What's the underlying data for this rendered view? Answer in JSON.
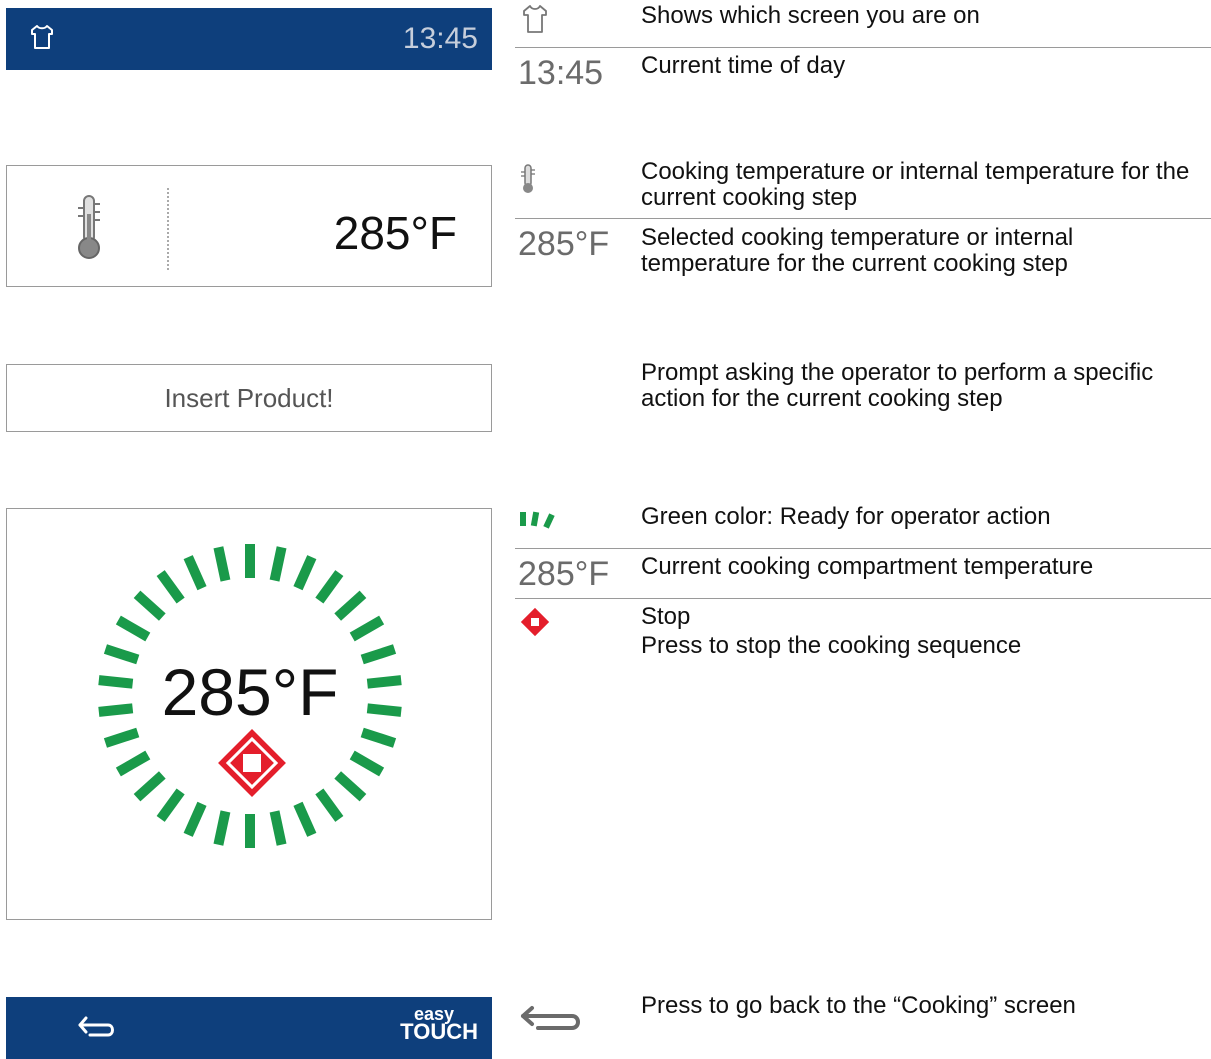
{
  "screen": {
    "time": "13:45",
    "temperature": "285°F",
    "prompt": "Insert Product!",
    "dial_temperature": "285°F",
    "logo_line1": "easy",
    "logo_line2": "TOUCH"
  },
  "legend": {
    "time_example": "13:45",
    "temp_example_1": "285°F",
    "temp_example_2": "285°F",
    "items": [
      {
        "icon": "chef-shirt-icon",
        "text": "Shows which screen you are on"
      },
      {
        "icon": "none",
        "text": "Current time of day"
      },
      {
        "icon": "thermometer-icon",
        "text": "Cooking temperature or internal temperature for the current cooking step"
      },
      {
        "icon": "none",
        "text": "Selected cooking temperature or internal temperature for the current cooking step"
      },
      {
        "icon": "none",
        "text": "Prompt asking the operator to perform a specific action for the current cooking step"
      },
      {
        "icon": "green-segments-icon",
        "text": "Green color: Ready for operator action"
      },
      {
        "icon": "none",
        "text": "Current cooking compartment temperature"
      },
      {
        "icon": "stop-icon",
        "text": "Stop"
      },
      {
        "icon": "none",
        "text": "Press to stop the cooking sequence"
      },
      {
        "icon": "back-arrow-icon",
        "text": "Press to go back to the “Cooking” screen"
      }
    ]
  },
  "colors": {
    "bar_blue": "#0e3f7c",
    "green": "#1a9a4a",
    "stop_red": "#e41e2b",
    "gray_text": "#6b6b6b"
  }
}
